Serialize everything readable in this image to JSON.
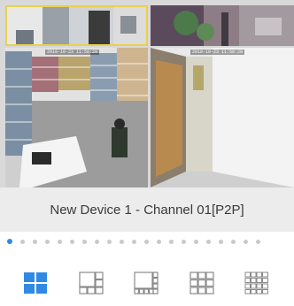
{
  "app": {
    "accent_color": "#2f8ae6"
  },
  "channels": [
    {
      "icon": "camera-feed-top-left",
      "timestamp": ""
    },
    {
      "icon": "camera-feed-top-right",
      "timestamp": ""
    },
    {
      "icon": "camera-feed-library",
      "timestamp": "2018-10-23 11:50:29"
    },
    {
      "icon": "camera-feed-hallway",
      "timestamp": "2018-10-23 11:50:29"
    }
  ],
  "selected_channel_label": "New Device 1 - Channel 01[P2P]",
  "pager": {
    "total_pages": 21,
    "current_page": 1
  },
  "layout_options": [
    {
      "name": "four-split-layout-icon",
      "selected": true
    },
    {
      "name": "six-split-layout-icon",
      "selected": false
    },
    {
      "name": "eight-split-layout-icon",
      "selected": false
    },
    {
      "name": "nine-split-layout-icon",
      "selected": false
    },
    {
      "name": "sixteen-split-layout-icon",
      "selected": false
    }
  ]
}
